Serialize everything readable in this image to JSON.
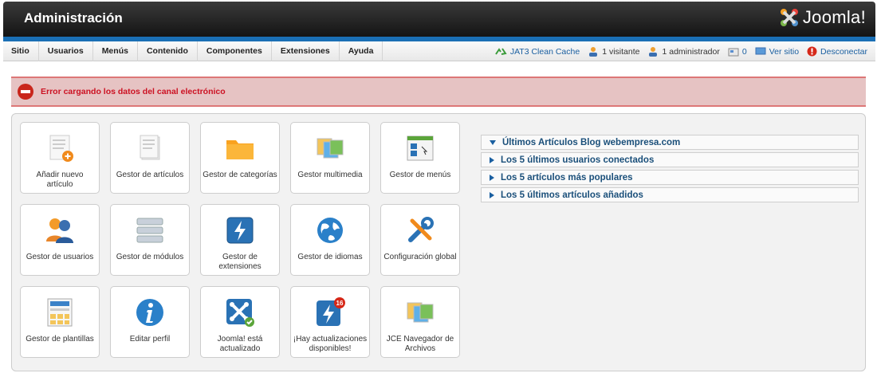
{
  "header": {
    "title": "Administración",
    "logo_text": "Joomla!"
  },
  "menu": [
    "Sitio",
    "Usuarios",
    "Menús",
    "Contenido",
    "Componentes",
    "Extensiones",
    "Ayuda"
  ],
  "status": {
    "cache": "JAT3 Clean Cache",
    "visitors": "1 visitante",
    "admins": "1 administrador",
    "messages": "0",
    "view_site": "Ver sitio",
    "logout": "Desconectar"
  },
  "error": {
    "message": "Error cargando los datos del canal electrónico"
  },
  "tiles": [
    {
      "label": "Añadir nuevo artículo",
      "icon": "add-article-icon"
    },
    {
      "label": "Gestor de artículos",
      "icon": "article-manager-icon"
    },
    {
      "label": "Gestor de categorías",
      "icon": "folder-icon"
    },
    {
      "label": "Gestor multimedia",
      "icon": "media-icon"
    },
    {
      "label": "Gestor de menús",
      "icon": "menu-manager-icon"
    },
    {
      "label": "Gestor de usuarios",
      "icon": "users-icon"
    },
    {
      "label": "Gestor de módulos",
      "icon": "modules-icon"
    },
    {
      "label": "Gestor de extensiones",
      "icon": "extensions-icon"
    },
    {
      "label": "Gestor de idiomas",
      "icon": "globe-icon"
    },
    {
      "label": "Configuración global",
      "icon": "tools-icon"
    },
    {
      "label": "Gestor de plantillas",
      "icon": "templates-icon"
    },
    {
      "label": "Editar perfil",
      "icon": "info-icon"
    },
    {
      "label": "Joomla! está actualizado",
      "icon": "joomla-ok-icon"
    },
    {
      "label": "¡Hay actualizaciones disponibles!",
      "icon": "updates-icon"
    },
    {
      "label": "JCE Navegador de Archivos",
      "icon": "jce-browser-icon"
    }
  ],
  "accordion": [
    {
      "label": "Últimos Artículos Blog webempresa.com",
      "expanded": true
    },
    {
      "label": "Los 5 últimos usuarios conectados",
      "expanded": false
    },
    {
      "label": "Los 5 artículos más populares",
      "expanded": false
    },
    {
      "label": "Los 5 últimos artículos añadidos",
      "expanded": false
    }
  ],
  "colors": {
    "brand_blue": "#1a6fb5",
    "error_red": "#c9261c",
    "link_blue": "#1a5fa0"
  }
}
